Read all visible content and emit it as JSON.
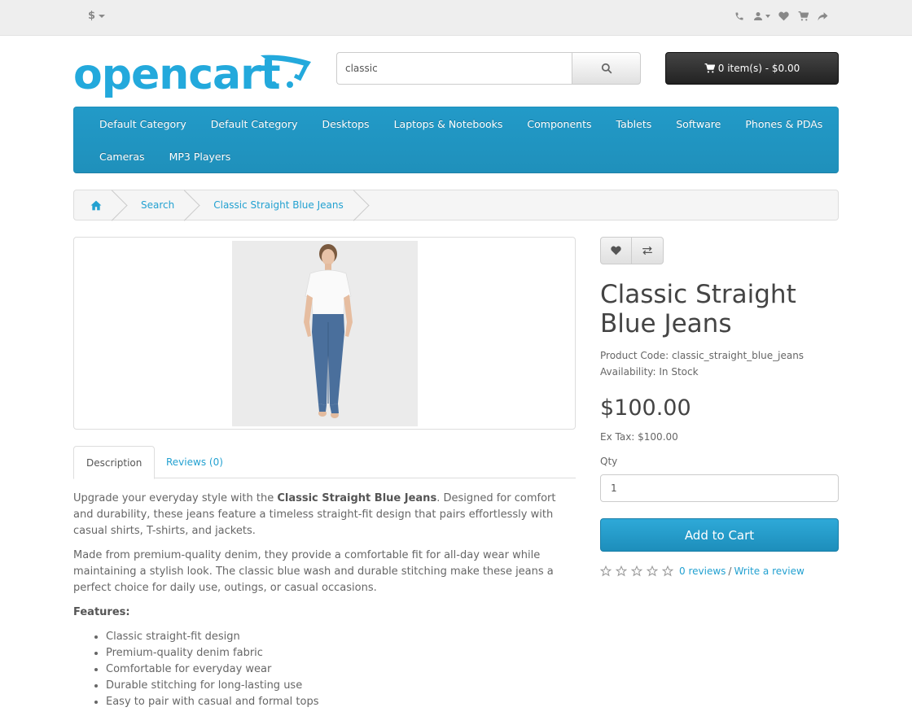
{
  "topbar": {
    "currency_label": "$",
    "icons": [
      "phone-icon",
      "user-icon",
      "heart-icon",
      "cart-icon",
      "share-icon"
    ]
  },
  "header": {
    "logo_text": "opencart",
    "search_value": "classic",
    "cart_label": "0 item(s) - $0.00"
  },
  "menu": {
    "row1": [
      "Default Category",
      "Default Category",
      "Desktops",
      "Laptops & Notebooks",
      "Components",
      "Tablets",
      "Software",
      "Phones & PDAs"
    ],
    "row2": [
      "Cameras",
      "MP3 Players"
    ]
  },
  "breadcrumb": {
    "items": [
      "Search",
      "Classic Straight Blue Jeans"
    ]
  },
  "tabs": {
    "description": "Description",
    "reviews": "Reviews (0)"
  },
  "description": {
    "p1_before": "Upgrade your everyday style with the ",
    "p1_bold": "Classic Straight Blue Jeans",
    "p1_after": ". Designed for comfort and durability, these jeans feature a timeless straight-fit design that pairs effortlessly with casual shirts, T-shirts, and jackets.",
    "p2": "Made from premium-quality denim, they provide a comfortable fit for all-day wear while maintaining a stylish look. The classic blue wash and durable stitching make these jeans a perfect choice for daily use, outings, or casual occasions.",
    "features_title": "Features:",
    "features": [
      "Classic straight-fit design",
      "Premium-quality denim fabric",
      "Comfortable for everyday wear",
      "Durable stitching for long-lasting use",
      "Easy to pair with casual and formal tops"
    ]
  },
  "product": {
    "title_line1": "Classic Straight",
    "title_line2": "Blue Jeans",
    "code": "Product Code: classic_straight_blue_jeans",
    "availability": "Availability: In Stock",
    "price": "$100.00",
    "ex_tax": "Ex Tax: $100.00",
    "qty_label": "Qty",
    "qty_value": "1",
    "add_to_cart": "Add to Cart",
    "rating_value": 0,
    "reviews_link": "0 reviews",
    "separator": "/",
    "write_review": "Write a review"
  },
  "colors": {
    "accent": "#229ac8",
    "link": "#23a1d1",
    "cart_button": "#333333"
  }
}
